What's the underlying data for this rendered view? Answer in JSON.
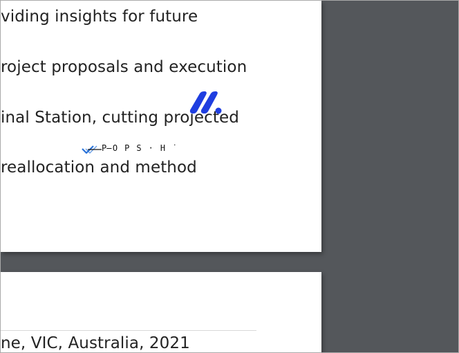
{
  "page1": {
    "lines": [
      "viding insights for future",
      "roject proposals and execution",
      "inal Station, cutting projected",
      " reallocation and method"
    ],
    "overlay_text": "P̶O P S · H ˙"
  },
  "page2": {
    "lines": [
      "ne, VIC, Australia, 2021"
    ]
  },
  "logo": {
    "icon": "brand-logo-icon",
    "color": "#1f3ee0"
  },
  "check": {
    "icon": "check-icon",
    "color": "#2a73d9"
  }
}
